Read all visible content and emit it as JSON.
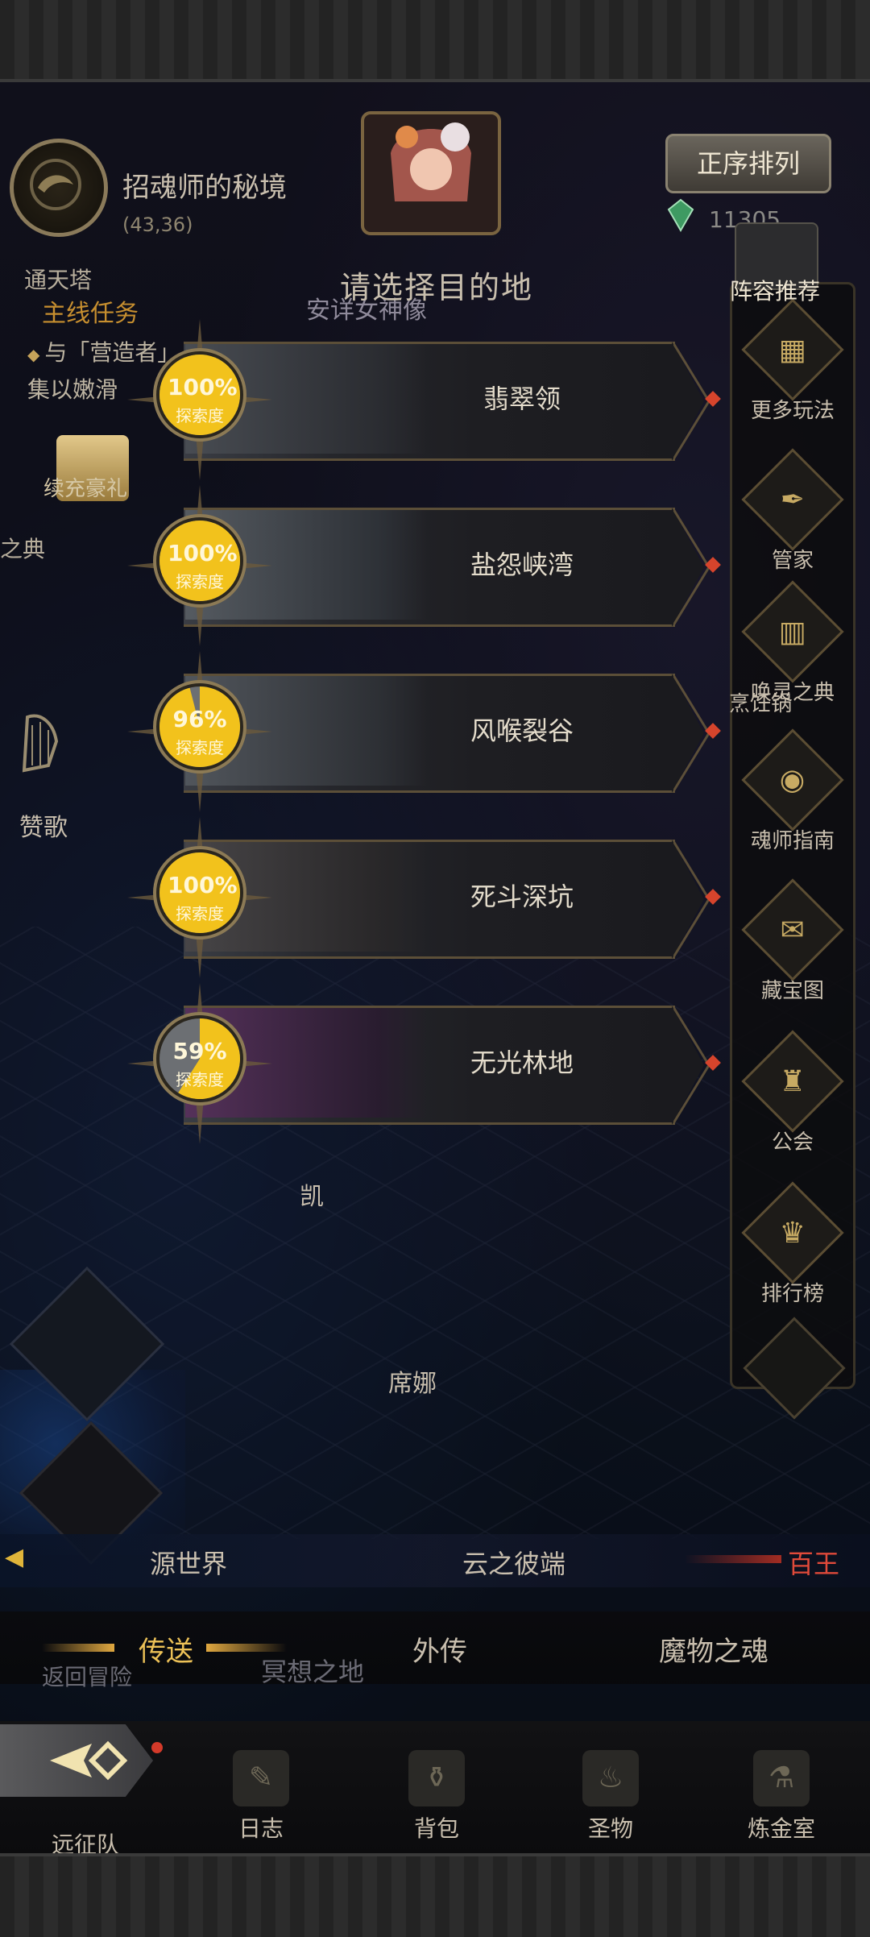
{
  "header": {
    "portal_name": "招魂师的秘境",
    "portal_coord": "(43,36)",
    "dest_title": "请选择目的地",
    "sort_button": "正序排列",
    "gem_count": "11305"
  },
  "left_panel": {
    "tower_label": "通天塔",
    "statue_label": "安详女神像",
    "quest_title": "主线任务",
    "quest_text": "与「营造者」集以嫩滑",
    "gift_label": "续充豪礼",
    "dian_label": "之典",
    "praise_label": "赞歌",
    "kai_label": "凯",
    "xina_label": "席娜"
  },
  "destinations": [
    {
      "name": "翡翠领",
      "percent": "100%",
      "explore_label": "探索度",
      "progress": 1.0
    },
    {
      "name": "盐怨峡湾",
      "percent": "100%",
      "explore_label": "探索度",
      "progress": 1.0
    },
    {
      "name": "风喉裂谷",
      "percent": "96%",
      "explore_label": "探索度",
      "progress": 0.96
    },
    {
      "name": "死斗深坑",
      "percent": "100%",
      "explore_label": "探索度",
      "progress": 1.0
    },
    {
      "name": "无光林地",
      "percent": "59%",
      "explore_label": "探索度",
      "progress": 0.59
    }
  ],
  "sidebar": {
    "lineup_label": "阵容推荐",
    "items": [
      {
        "label": "更多玩法",
        "icon": "gift-box-icon",
        "glyph": "▦"
      },
      {
        "label": "管家",
        "icon": "butler-icon",
        "glyph": "✒"
      },
      {
        "label": "唤灵之典",
        "icon": "book-icon",
        "glyph": "▥"
      },
      {
        "label": "烹饪锅",
        "icon": "cooking-pot-icon",
        "glyph": ""
      },
      {
        "label": "魂师指南",
        "icon": "guide-icon",
        "glyph": "◉"
      },
      {
        "label": "藏宝图",
        "icon": "treasure-map-icon",
        "glyph": "✉"
      },
      {
        "label": "公会",
        "icon": "guild-icon",
        "glyph": "♜"
      },
      {
        "label": "排行榜",
        "icon": "trophy-icon",
        "glyph": "♛"
      }
    ]
  },
  "world_tabs": [
    "源世界",
    "云之彼端",
    "百王"
  ],
  "function_tabs": [
    "传送",
    "外传",
    "魔物之魂"
  ],
  "ghost_labels": [
    "返回冒险",
    "冥想之地"
  ],
  "bottom_nav": [
    {
      "label": "远征队",
      "icon": "expedition-icon"
    },
    {
      "label": "日志",
      "icon": "journal-icon",
      "glyph": "✎"
    },
    {
      "label": "背包",
      "icon": "backpack-icon",
      "glyph": "⚱"
    },
    {
      "label": "圣物",
      "icon": "relic-icon",
      "glyph": "♨"
    },
    {
      "label": "炼金室",
      "icon": "alchemy-icon",
      "glyph": "⚗"
    }
  ],
  "colors": {
    "accent_gold": "#ecc157",
    "alert_red": "#e04a3a",
    "gauge_fill": "#f2c21c"
  }
}
